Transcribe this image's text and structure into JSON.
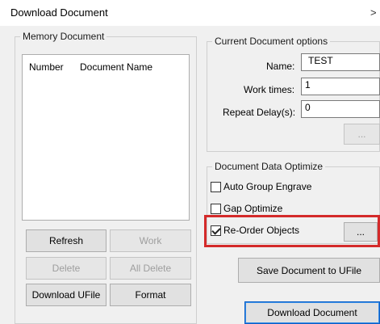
{
  "window": {
    "title": "Download Document",
    "close_glyph": ">"
  },
  "memory_document": {
    "group_title": "Memory Document",
    "columns": [
      "Number",
      "Document Name"
    ]
  },
  "left_buttons": {
    "refresh": "Refresh",
    "work": "Work",
    "delete": "Delete",
    "all_delete": "All Delete",
    "download_ufile": "Download UFile",
    "format": "Format"
  },
  "current_options": {
    "group_title": "Current Document options",
    "name_label": "Name:",
    "name_value": "TEST",
    "work_times_label": "Work times:",
    "work_times_value": "1",
    "repeat_delay_label": "Repeat Delay(s):",
    "repeat_delay_value": "0",
    "browse_button": "..."
  },
  "optimize": {
    "group_title": "Document Data Optimize",
    "auto_group": {
      "label": "Auto Group Engrave",
      "checked": false
    },
    "gap_optimize": {
      "label": "Gap Optimize",
      "checked": false
    },
    "reorder": {
      "label": "Re-Order Objects",
      "checked": true
    },
    "reorder_button": "..."
  },
  "right_buttons": {
    "save_to_ufile": "Save Document to UFile",
    "download_document": "Download Document"
  },
  "colors": {
    "highlight": "#d42a2a",
    "panel": "#f0f0f0"
  }
}
